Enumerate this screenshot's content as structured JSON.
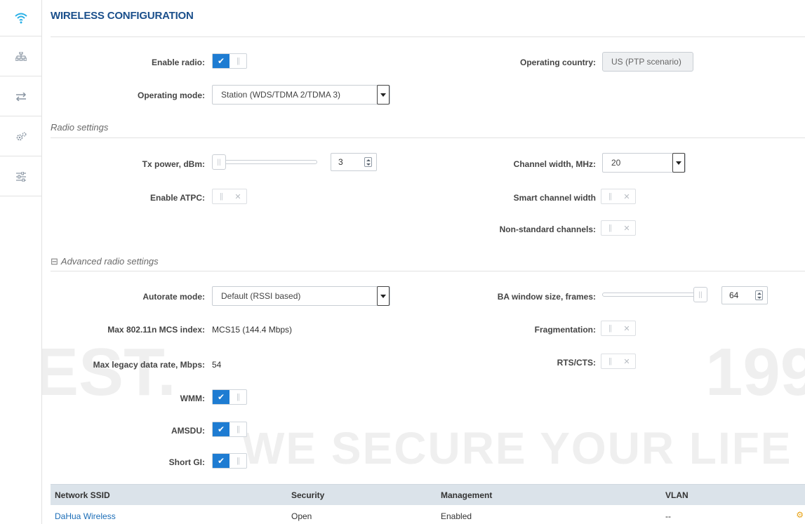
{
  "page": {
    "title": "WIRELESS CONFIGURATION"
  },
  "rail": {
    "items": [
      {
        "icon": "wifi-icon"
      },
      {
        "icon": "network-topology-icon"
      },
      {
        "icon": "transfer-arrows-icon"
      },
      {
        "icon": "gears-icon"
      },
      {
        "icon": "sliders-icon"
      }
    ]
  },
  "general": {
    "enable_radio_label": "Enable radio:",
    "enable_radio": true,
    "operating_mode_label": "Operating mode:",
    "operating_mode_value": "Station (WDS/TDMA 2/TDMA 3)",
    "operating_country_label": "Operating country:",
    "operating_country_value": "US (PTP scenario)"
  },
  "radio_settings": {
    "title": "Radio settings",
    "tx_power_label": "Tx power, dBm:",
    "tx_power_value": "3",
    "tx_power_level": 0,
    "enable_atpc_label": "Enable ATPC:",
    "enable_atpc": false,
    "channel_width_label": "Channel width, MHz:",
    "channel_width_value": "20",
    "smart_channel_width_label": "Smart channel width",
    "smart_channel_width": false,
    "non_standard_channels_label": "Non-standard channels:",
    "non_standard_channels": false
  },
  "advanced": {
    "title": "Advanced radio settings",
    "toggle_symbol": "⊟",
    "autorate_mode_label": "Autorate mode:",
    "autorate_mode_value": "Default (RSSI based)",
    "max_mcs_label": "Max 802.11n MCS index:",
    "max_mcs_value": "MCS15 (144.4 Mbps)",
    "max_legacy_label": "Max legacy data rate, Mbps:",
    "max_legacy_value": "54",
    "wmm_label": "WMM:",
    "wmm": true,
    "amsdu_label": "AMSDU:",
    "amsdu": true,
    "short_gi_label": "Short GI:",
    "short_gi": true,
    "ba_window_label": "BA window size, frames:",
    "ba_window_value": "64",
    "ba_window_level": 1,
    "fragmentation_label": "Fragmentation:",
    "fragmentation": false,
    "rts_cts_label": "RTS/CTS:",
    "rts_cts": false
  },
  "ssid_table": {
    "headers": [
      "Network SSID",
      "Security",
      "Management",
      "VLAN"
    ],
    "rows": [
      {
        "ssid": "DaHua Wireless",
        "security": "Open",
        "management": "Enabled",
        "vlan": "--"
      }
    ]
  },
  "watermark": {
    "slogan": "WE SECURE YOUR LIFE",
    "est": "EST.",
    "year": "199"
  },
  "colors": {
    "accent": "#1e7cd2",
    "title": "#1a4f8b",
    "table_header": "#dbe3ea",
    "link": "#1b6db7",
    "action": "#e8a317"
  }
}
